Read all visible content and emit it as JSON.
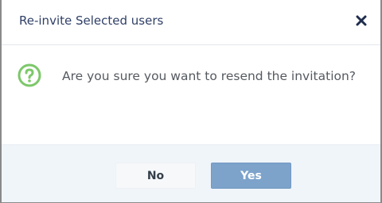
{
  "dialog": {
    "title": "Re-invite Selected users",
    "close_icon": "close-icon",
    "message": "Are you sure you want to resend the invitation?",
    "message_icon": "question-icon",
    "buttons": {
      "no_label": "No",
      "yes_label": "Yes"
    }
  },
  "colors": {
    "title": "#2f3f66",
    "question_icon": "#7cc86a",
    "footer_bg": "#f0f5fa",
    "yes_button": "#7da3cb"
  }
}
